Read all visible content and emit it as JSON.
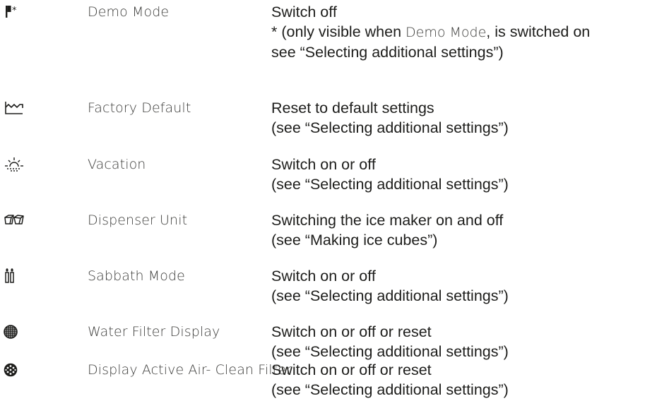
{
  "rows": [
    {
      "icon": "demo-mode-flag-icon",
      "name": [
        "Demo Mode"
      ],
      "desc": [
        "Switch off"
      ],
      "note_prefix": "* (only visible when ",
      "note_ui": "Demo Mode",
      "note_suffix": ", is switched on",
      "note_line2": "see “Selecting additional settings”)"
    },
    {
      "icon": "factory-icon",
      "name": [
        "Factory Default"
      ],
      "desc": [
        "Reset to default settings",
        "(see “Selecting additional settings”)"
      ]
    },
    {
      "icon": "sun-icon",
      "name": [
        "Vacation"
      ],
      "desc": [
        "Switch on or off",
        "(see “Selecting additional settings”)"
      ]
    },
    {
      "icon": "ice-cubes-icon",
      "name": [
        "Dispenser Unit"
      ],
      "desc": [
        "Switching the ice maker on and off",
        "(see “Making ice cubes”)"
      ]
    },
    {
      "icon": "candles-icon",
      "name": [
        "Sabbath Mode"
      ],
      "desc": [
        "Switch on or off",
        "(see “Selecting additional settings”)"
      ]
    },
    {
      "icon": "water-filter-icon",
      "name": [
        "Water Filter Display"
      ],
      "desc": [
        "Switch on or off or reset",
        "(see “Selecting additional settings”)"
      ]
    },
    {
      "icon": "air-filter-icon",
      "name": [
        "Display Active Air-",
        "Clean Filter"
      ],
      "desc": [
        "Switch on or off or reset",
        "(see “Selecting additional settings”)"
      ]
    }
  ]
}
